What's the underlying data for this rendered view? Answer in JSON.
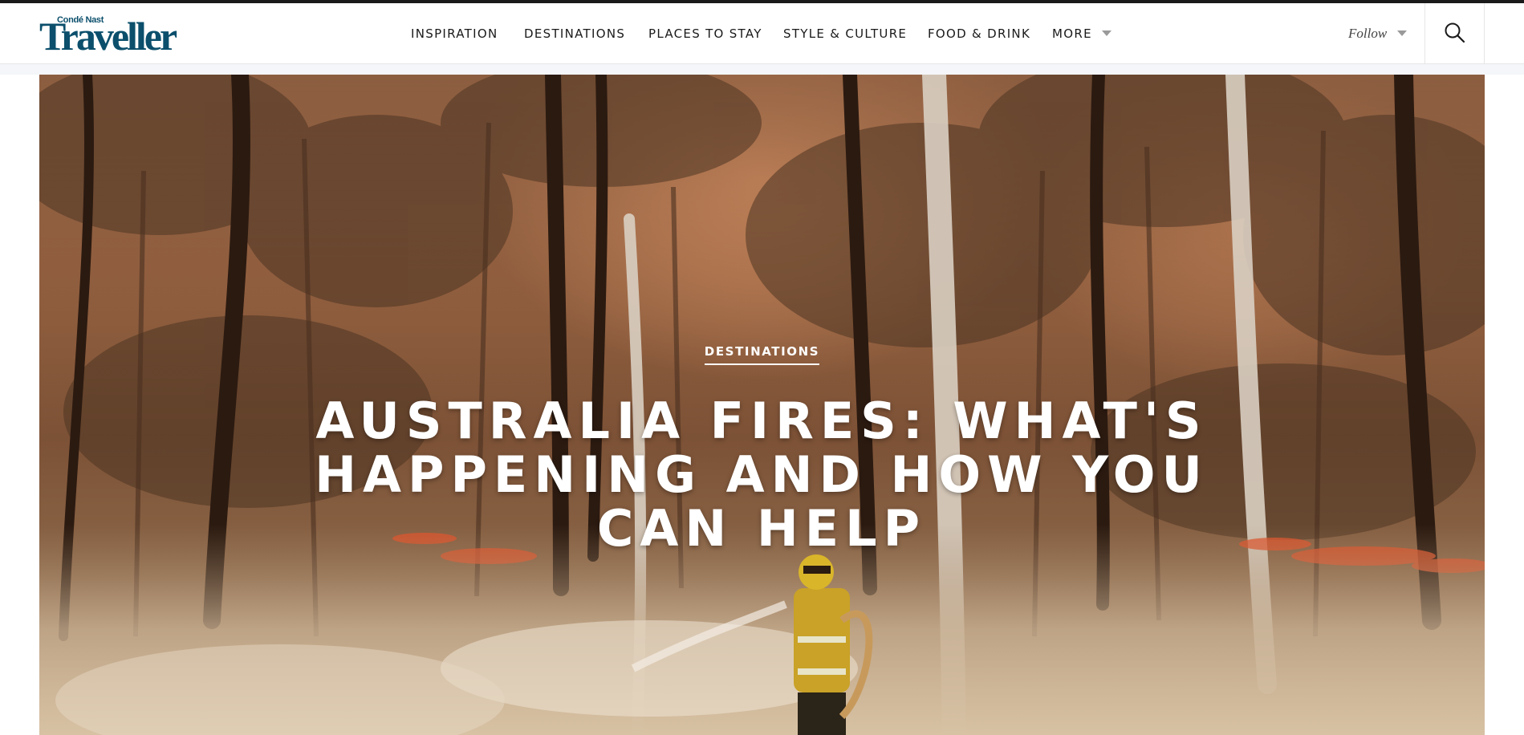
{
  "brand": {
    "logo_small": "Condé Nast",
    "logo_big": "Traveller",
    "color": "#0b4f6c"
  },
  "nav": {
    "items": [
      {
        "label": "INSPIRATION"
      },
      {
        "label": "DESTINATIONS"
      },
      {
        "label": "PLACES TO STAY"
      },
      {
        "label": "STYLE & CULTURE"
      },
      {
        "label": "FOOD & DRINK"
      },
      {
        "label": "MORE"
      }
    ],
    "more_icon": "chevron-down-icon"
  },
  "header_right": {
    "follow_label": "Follow",
    "follow_icon": "chevron-down-icon",
    "search_icon": "search-icon"
  },
  "hero": {
    "kicker": "DESTINATIONS",
    "headline": "AUSTRALIA FIRES: WHAT'S HAPPENING AND HOW YOU CAN HELP",
    "image_description_icon": "bushfire-firefighter-photo"
  }
}
